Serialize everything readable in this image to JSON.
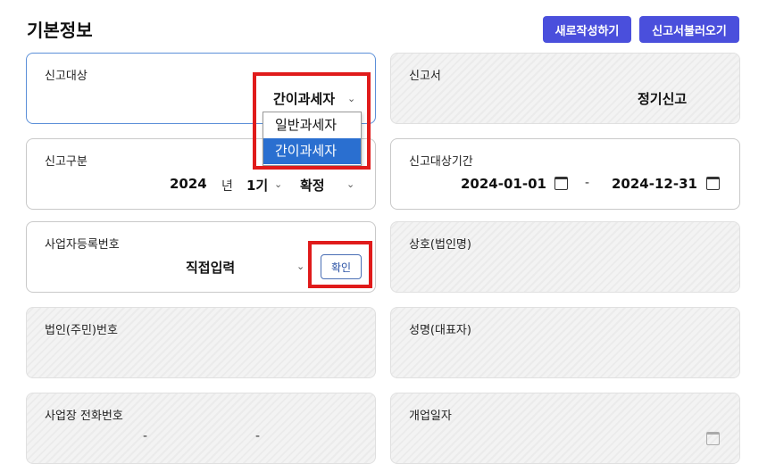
{
  "header": {
    "title": "기본정보",
    "new_button": "새로작성하기",
    "load_button": "신고서불러오기"
  },
  "fields": {
    "report_target": {
      "label": "신고대상",
      "value": "간이과세자",
      "options": [
        "일반과세자",
        "간이과세자"
      ]
    },
    "report_form": {
      "label": "신고서",
      "value": "정기신고"
    },
    "report_type": {
      "label": "신고구분",
      "year": "2024",
      "year_unit": "년",
      "period": "1기",
      "status": "확정"
    },
    "report_period": {
      "label": "신고대상기간",
      "start": "2024-01-01",
      "separator": "-",
      "end": "2024-12-31"
    },
    "business_no": {
      "label": "사업자등록번호",
      "mode": "직접입력",
      "confirm": "확인"
    },
    "company_name": {
      "label": "상호(법인명)"
    },
    "corp_no": {
      "label": "법인(주민)번호"
    },
    "rep_name": {
      "label": "성명(대표자)"
    },
    "phone": {
      "label": "사업장 전화번호",
      "sep1": "-",
      "sep2": "-"
    },
    "open_date": {
      "label": "개업일자"
    }
  },
  "colors": {
    "accent": "#4a4fdc",
    "highlight": "#e01b1b",
    "selected": "#2a6fd0"
  }
}
